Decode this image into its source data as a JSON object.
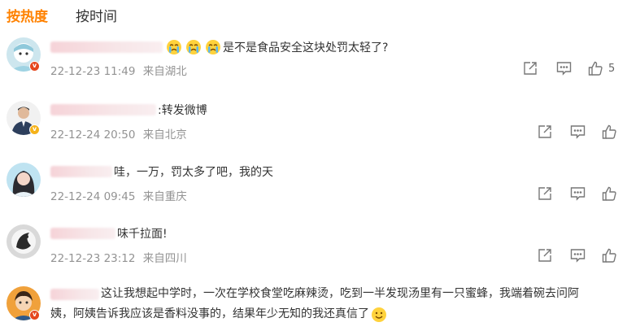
{
  "tabs": {
    "hot": "按热度",
    "time": "按时间"
  },
  "comments": [
    {
      "text": "是不是食品安全这块处罚太轻了?",
      "date": "22-12-23 11:49",
      "loc": "来自湖北",
      "likes": "5",
      "badge": "red"
    },
    {
      "text": ":转发微博",
      "date": "22-12-24 20:50",
      "loc": "来自北京",
      "badge": "gold"
    },
    {
      "text": "哇，一万，罚太多了吧，我的天",
      "date": "22-12-24 09:45",
      "loc": "来自重庆"
    },
    {
      "text": "味千拉面!",
      "date": "22-12-23 23:12",
      "loc": "来自四川"
    },
    {
      "text1": "这让我想起中学时，一次在学校食堂吃麻辣烫，吃到一半发现汤里有一只蜜蜂，我端着碗去问阿",
      "text2": "姨，阿姨告诉我应该是香料没事的，结果年少无知的我还真信了",
      "badge": "red"
    }
  ],
  "colors": {
    "accent": "#ff8200",
    "meta": "#939393",
    "icon": "#777777"
  },
  "icons": [
    "share-icon",
    "comment-icon",
    "like-icon"
  ]
}
